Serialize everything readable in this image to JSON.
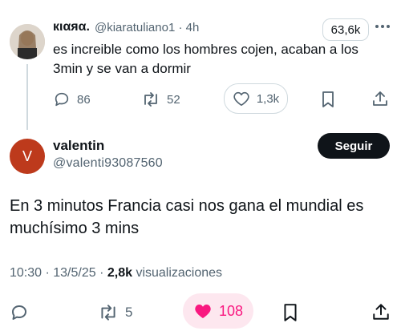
{
  "parent": {
    "display_name": "кιαяα.",
    "handle_time": "@kiaratuliano1 · 4h",
    "views": "63,6k",
    "text": "es increible como los hombres cojen, acaban a los 3min y se van a dormir",
    "replies": "86",
    "retweets": "52",
    "likes": "1,3k"
  },
  "main": {
    "avatar_letter": "V",
    "display_name": "valentin",
    "handle": "@valenti93087560",
    "follow_label": "Seguir",
    "text": "En 3 minutos Francia casi nos gana el mundial es muchísimo 3 mins",
    "meta_time": "10:30 · 13/5/25 · ",
    "meta_views": "2,8k",
    "meta_views_label": " visualizaciones",
    "retweets": "5",
    "likes": "108"
  },
  "colors": {
    "like_active": "#f91880",
    "avatar_bg": "#bd3a1c",
    "gray": "#536471"
  },
  "icons": [
    "more-icon",
    "reply-icon",
    "retweet-icon",
    "heart-icon",
    "bookmark-icon",
    "share-icon"
  ]
}
